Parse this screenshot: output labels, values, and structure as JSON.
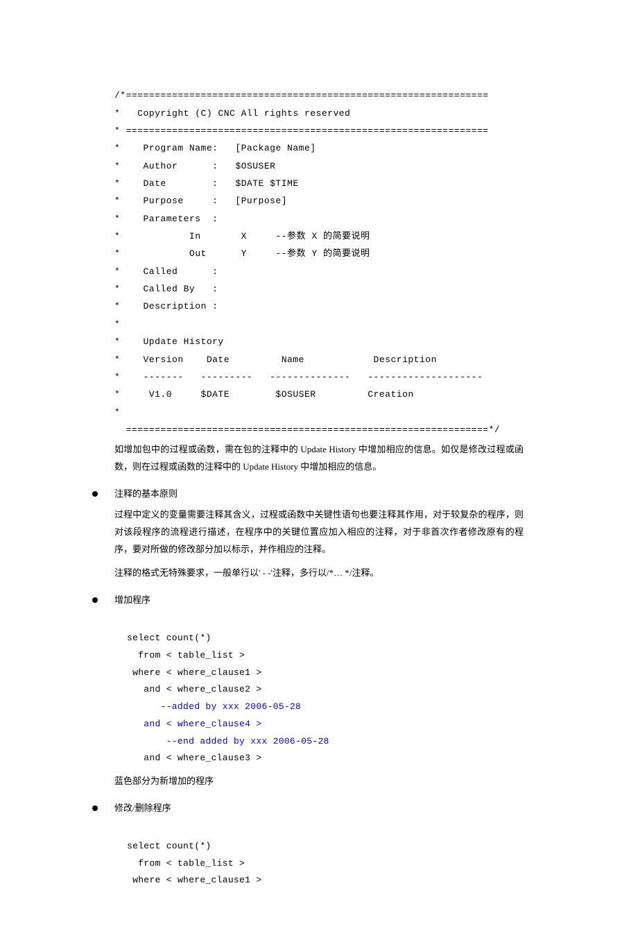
{
  "codeHeader": {
    "l1": "/*===============================================================",
    "l2": "*   Copyright (C) CNC All rights reserved",
    "l3": "* ===============================================================",
    "l4": "*    Program Name:   [Package Name]",
    "l5": "*    Author      :   $OSUSER",
    "l6": "*    Date        :   $DATE $TIME",
    "l7": "*    Purpose     :   [Purpose]",
    "l8": "*    Parameters  :",
    "l9": "*            In       X     --参数 X 的简要说明",
    "l10": "*            Out      Y     --参数 Y 的简要说明",
    "l11": "*    Called      :",
    "l12": "*    Called By   :",
    "l13": "*    Description :",
    "l14": "*",
    "l15": "*    Update History",
    "l16": "*    Version    Date         Name            Description",
    "l17": "*    -------   ---------   --------------   --------------------",
    "l18": "*     V1.0     $DATE        $OSUSER         Creation",
    "l19": "*",
    "l20": "  ===============================================================*/"
  },
  "para1": "如增加包中的过程或函数，需在包的注释中的 Update History 中增加相应的信息。如仅是修改过程或函数，则在过程或函数的注释中的 Update History 中增加相应的信息。",
  "bullet1": "注释的基本原则",
  "para2": "过程中定义的变量需要注释其含义，过程或函数中关键性语句也要注释其作用，对于较复杂的程序，则对该段程序的流程进行描述，在程序中的关键位置应加入相应的注释，对于非首次作者修改原有的程序，要对所做的修改部分加以标示，并作相应的注释。",
  "para3": "注释的格式无特殊要求，一般单行以' - -'注释，多行以/*… */注释。",
  "bullet2": "增加程序",
  "code2": {
    "c1": "select count(*)",
    "c2": "  from < table_list >",
    "c3": " where < where_clause1 >",
    "c4": "   and < where_clause2 >",
    "c5": "      --added by xxx 2006-05-28",
    "c6": "   and < where_clause4 >",
    "c7": "       --end added by xxx 2006-05-28",
    "c8": "   and < where_clause3 >"
  },
  "para4": "蓝色部分为新增加的程序",
  "bullet3": "修改/删除程序",
  "code3": {
    "c1": "select count(*)",
    "c2": "  from < table_list >",
    "c3": " where < where_clause1 >"
  }
}
